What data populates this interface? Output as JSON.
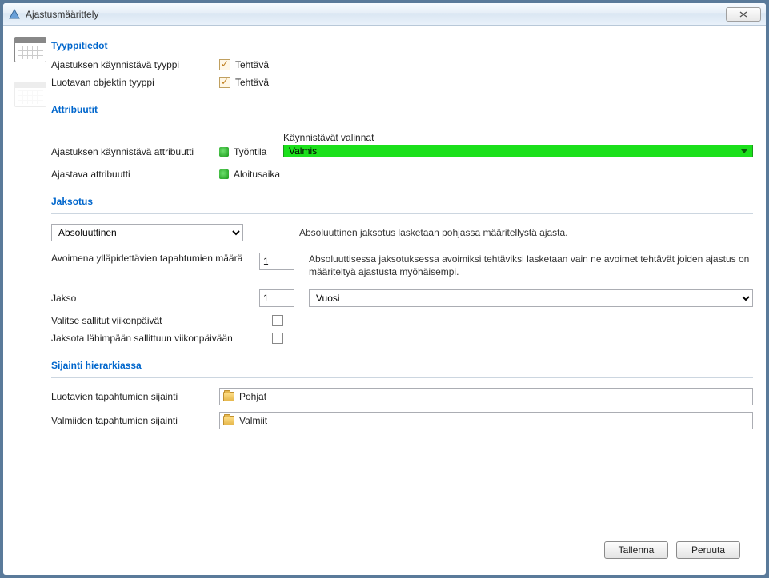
{
  "window": {
    "title": "Ajastusmäärittely"
  },
  "sections": {
    "type": {
      "title": "Tyyppitiedot",
      "row1_label": "Ajastuksen käynnistävä tyyppi",
      "row1_value": "Tehtävä",
      "row2_label": "Luotavan objektin tyyppi",
      "row2_value": "Tehtävä"
    },
    "attributes": {
      "title": "Attribuutit",
      "trigger_attr_label": "Ajastuksen käynnistävä attribuutti",
      "trigger_attr_value": "Työntila",
      "options_label": "Käynnistävät valinnat",
      "options_value": "Valmis",
      "timing_attr_label": "Ajastava attribuutti",
      "timing_attr_value": "Aloitusaika"
    },
    "period": {
      "title": "Jaksotus",
      "mode_value": "Absoluuttinen",
      "mode_desc": "Absoluuttinen jaksotus lasketaan pohjassa määritellystä ajasta.",
      "open_count_label": "Avoimena ylläpidettävien tapahtumien määrä",
      "open_count_value": "1",
      "open_count_desc": "Absoluuttisessa jaksotuksessa avoimiksi tehtäviksi lasketaan vain ne avoimet tehtävät joiden ajastus on määriteltyä ajastusta myöhäisempi.",
      "period_label": "Jakso",
      "period_num": "1",
      "period_unit": "Vuosi",
      "weekdays_label": "Valitse sallitut viikonpäivät",
      "nearest_label": "Jaksota lähimpään sallittuun viikonpäivään"
    },
    "location": {
      "title": "Sijainti hierarkiassa",
      "create_label": "Luotavien tapahtumien sijainti",
      "create_value": "Pohjat",
      "done_label": "Valmiiden tapahtumien sijainti",
      "done_value": "Valmiit"
    }
  },
  "buttons": {
    "save": "Tallenna",
    "cancel": "Peruuta"
  }
}
